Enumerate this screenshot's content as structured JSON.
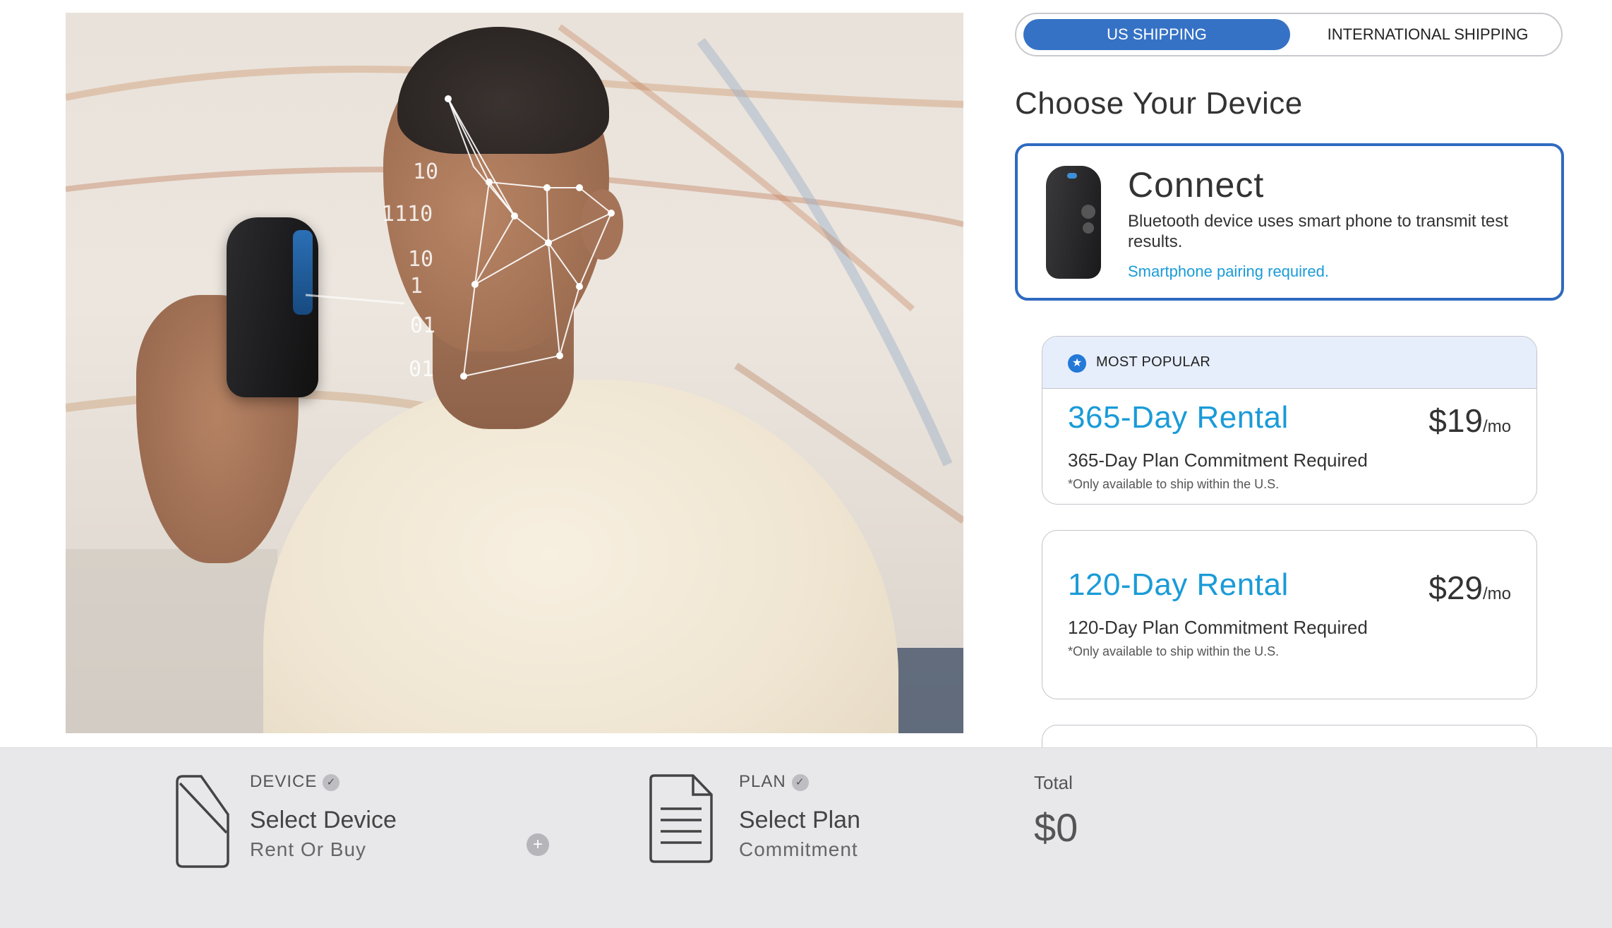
{
  "shipping": {
    "us_label": "US SHIPPING",
    "intl_label": "INTERNATIONAL SHIPPING"
  },
  "section_title": "Choose Your Device",
  "device": {
    "name": "Connect",
    "description": "Bluetooth device uses smart phone to transmit test results.",
    "note": "Smartphone pairing required."
  },
  "plans": [
    {
      "badge": "MOST POPULAR",
      "name": "365-Day Rental",
      "price": "$19",
      "per": "/mo",
      "commitment": "365-Day Plan Commitment Required",
      "fine_print": "*Only available to ship within the U.S."
    },
    {
      "name": "120-Day Rental",
      "price": "$29",
      "per": "/mo",
      "commitment": "120-Day Plan Commitment Required",
      "fine_print": "*Only available to ship within the U.S."
    }
  ],
  "hero_binary": [
    "10",
    "1110",
    "10",
    "1",
    "01",
    "01"
  ],
  "footer": {
    "device_label": "DEVICE",
    "device_title": "Select Device",
    "device_sub": "Rent Or Buy",
    "plus": "+",
    "plan_label": "PLAN",
    "plan_title": "Select Plan",
    "plan_sub": "Commitment",
    "total_label": "Total",
    "total_value": "$0"
  },
  "colors": {
    "accent_blue": "#3572c6",
    "link_blue": "#1a9bd7",
    "card_border": "#2f6ac0",
    "popular_bg": "#e6eefb",
    "footer_bg": "#e8e8eb"
  },
  "icons": [
    "star-icon",
    "check-icon",
    "plus-icon",
    "device-outline-icon",
    "document-icon"
  ]
}
